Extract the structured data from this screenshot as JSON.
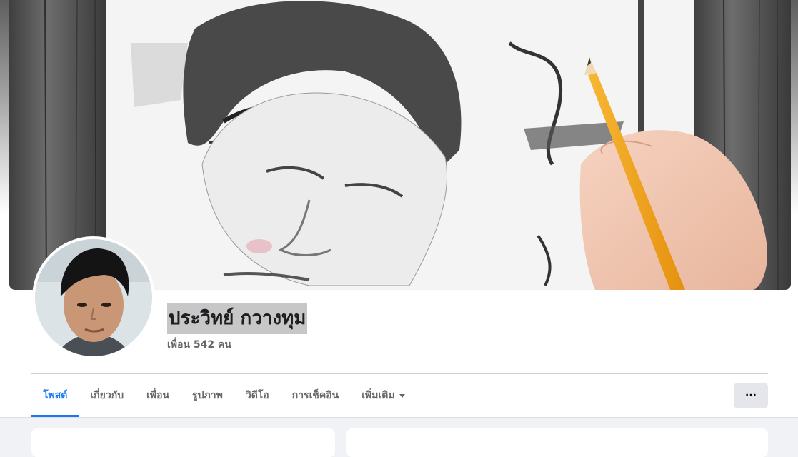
{
  "profile": {
    "name": "ประวิทย์ กวางทุม",
    "friends_count": "เพื่อน 542 คน"
  },
  "tabs": [
    {
      "label": "โพสต์",
      "active": true
    },
    {
      "label": "เกี่ยวกับ",
      "active": false
    },
    {
      "label": "เพื่อน",
      "active": false
    },
    {
      "label": "รูปภาพ",
      "active": false
    },
    {
      "label": "วิดีโอ",
      "active": false
    },
    {
      "label": "การเช็คอิน",
      "active": false
    },
    {
      "label": "เพิ่มเติม",
      "active": false
    }
  ],
  "more_button": {
    "label": "···",
    "icon": "ellipsis-icon"
  },
  "colors": {
    "accent": "#1877f2",
    "tab_text": "#65676b",
    "name_highlight": "#c7c7c7",
    "page_bg": "#f0f2f5"
  }
}
